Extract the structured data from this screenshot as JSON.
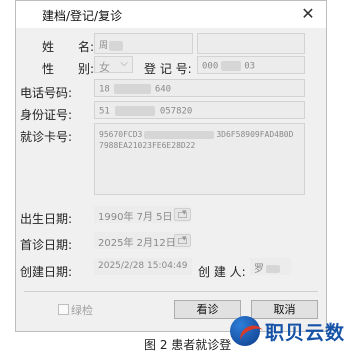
{
  "window": {
    "title": "建档/登记/复诊",
    "close_glyph": "✕"
  },
  "form": {
    "name_label": "姓　　名:",
    "name_value": "周",
    "gender_label": "性　　别:",
    "gender_value": "女",
    "reg_label": "登 记 号:",
    "reg_prefix": "000",
    "reg_suffix": "03",
    "phone_label": "电话号码:",
    "phone_prefix": "18",
    "phone_suffix": "640",
    "id_label": "身份证号:",
    "id_prefix": "51",
    "id_suffix": "057820",
    "card_label": "就诊卡号:",
    "card_line1_prefix": "95670FCD3",
    "card_line1_suffix": "3D6F58909FAD4B0D",
    "card_line2": "7988EA21023FE6E28D22",
    "birth_label": "出生日期:",
    "birth_value": "1990年 7月 5日",
    "first_visit_label": "首诊日期:",
    "first_visit_value": "2025年 2月12日",
    "created_label": "创建日期:",
    "created_value": "2025/2/28 15:04:49",
    "creator_label": "创 建 人:",
    "creator_value": "罗"
  },
  "footer": {
    "review_label": "绿检",
    "view_button": "看诊",
    "cancel_button": "取消"
  },
  "caption": "图 2  患者就诊登",
  "brand": {
    "name": "职贝云数"
  }
}
